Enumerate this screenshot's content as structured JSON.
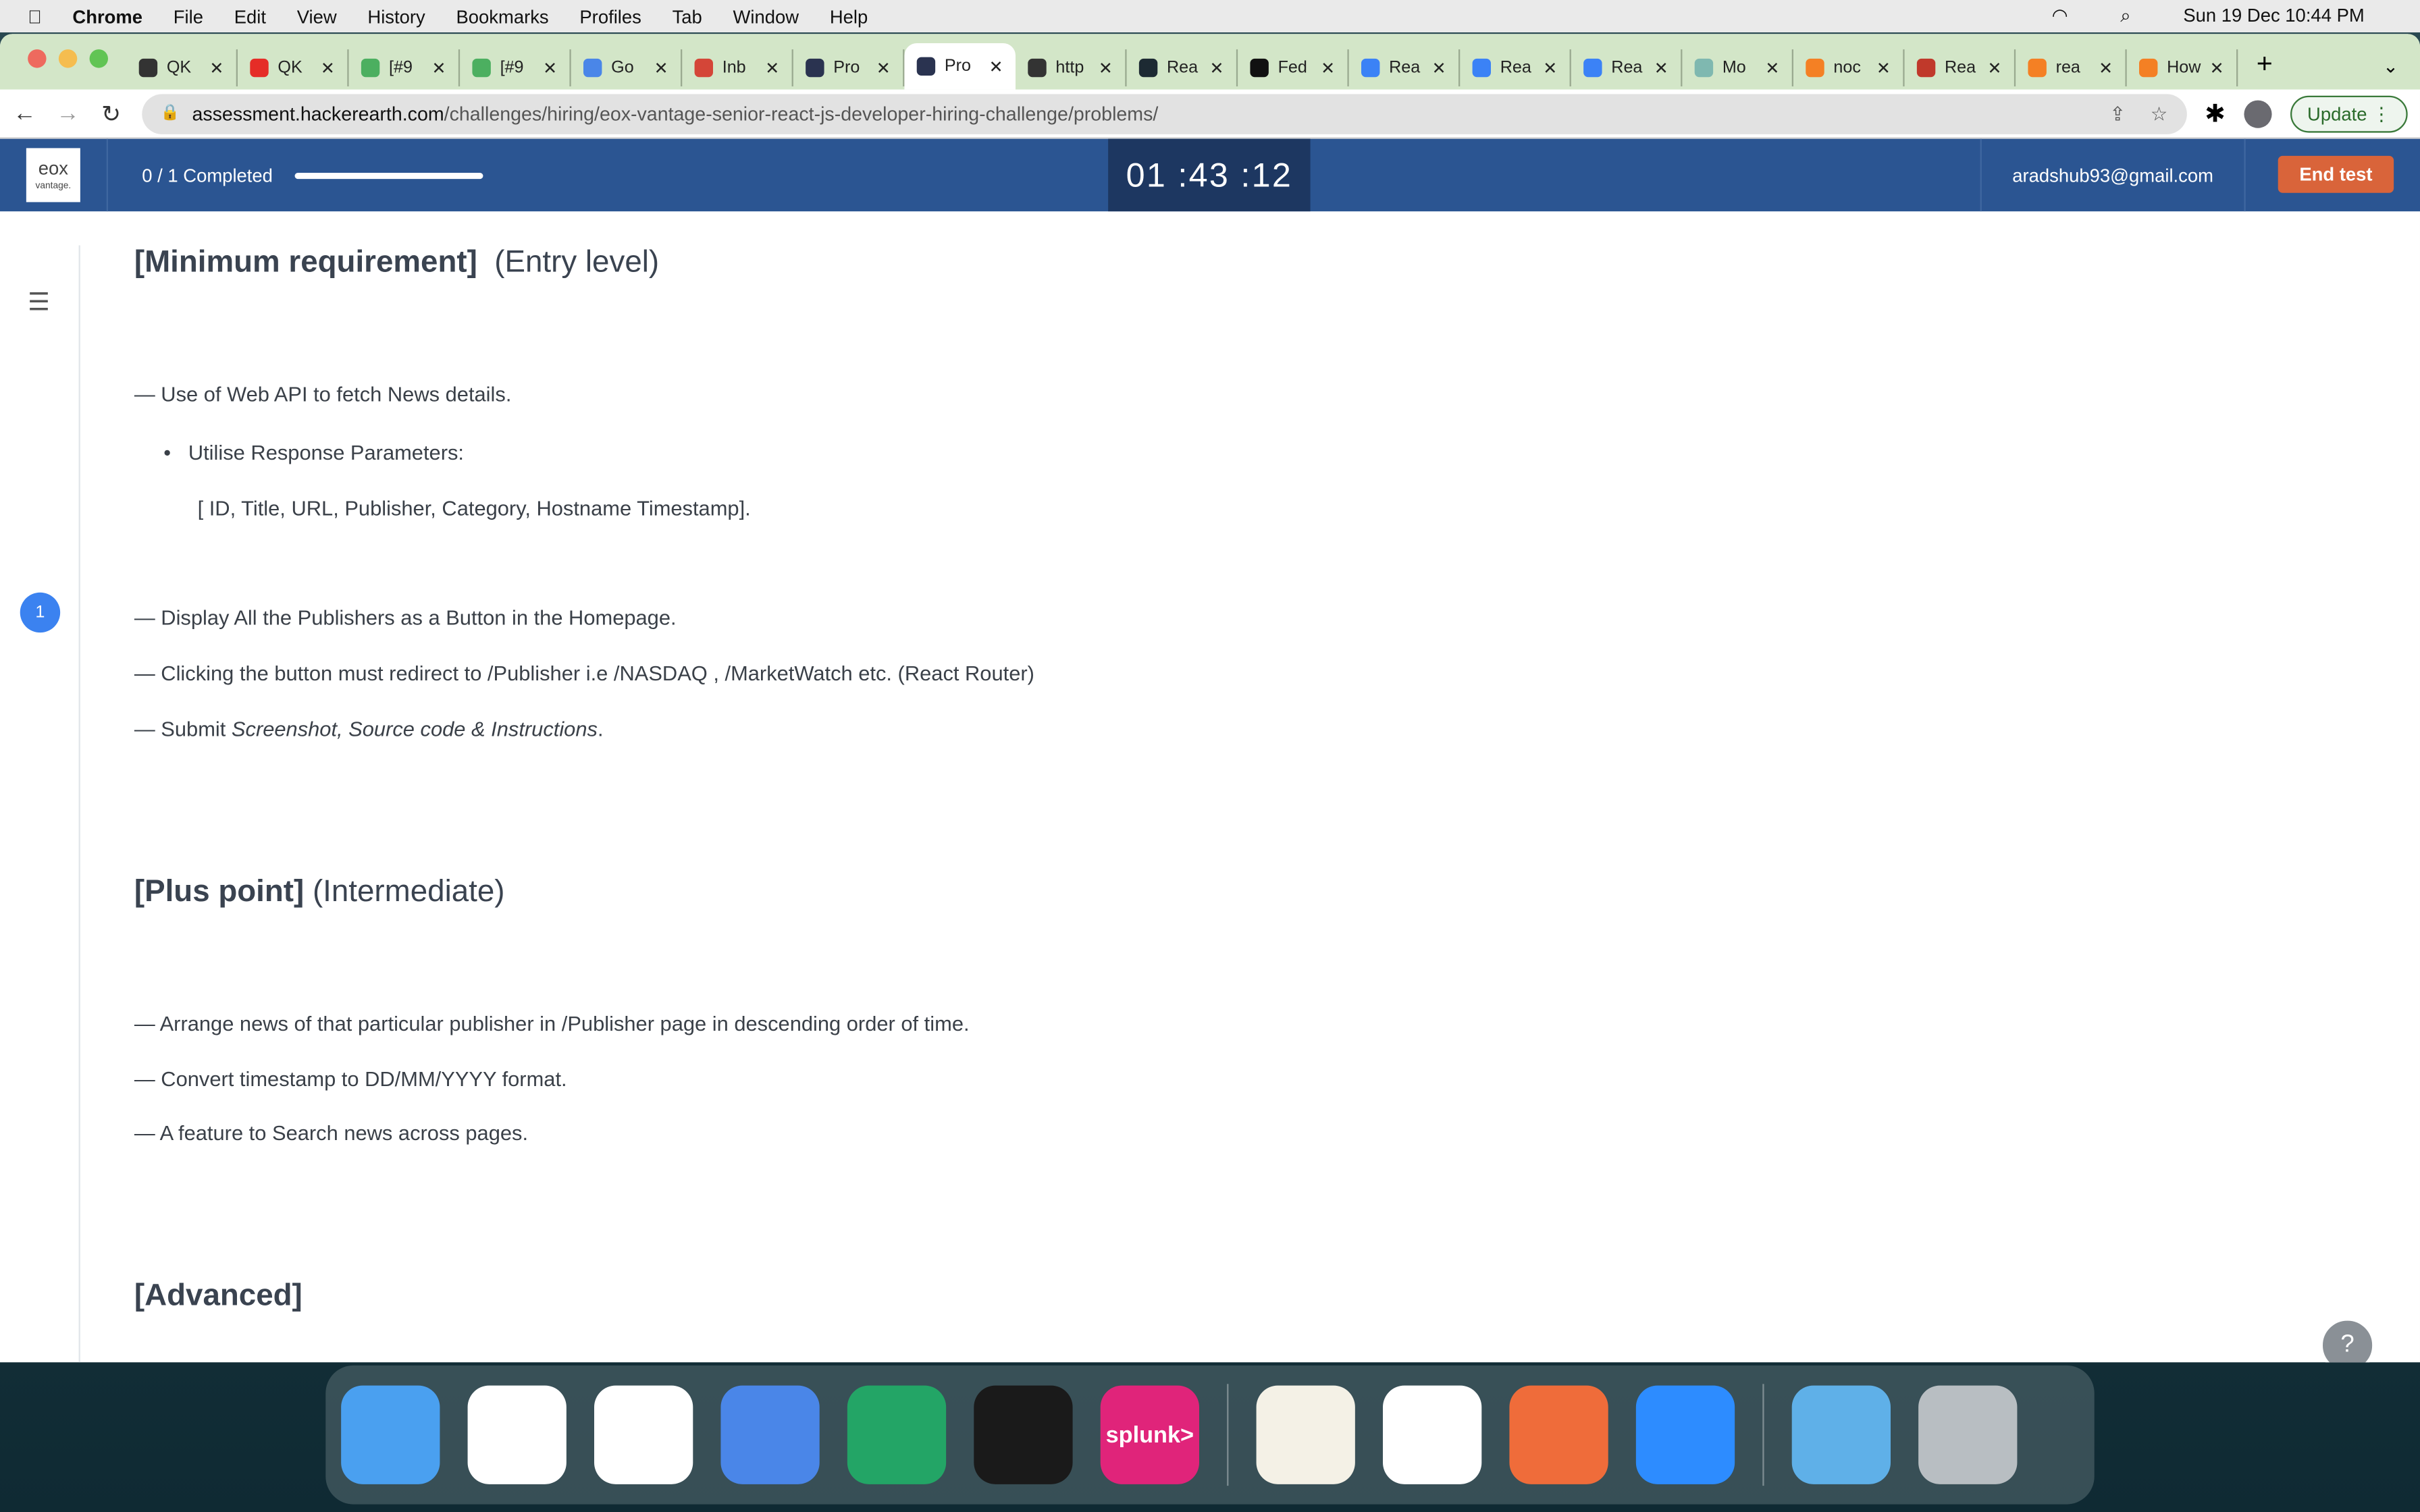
{
  "menubar": {
    "app": "Chrome",
    "items": [
      "File",
      "Edit",
      "View",
      "History",
      "Bookmarks",
      "Profiles",
      "Tab",
      "Window",
      "Help"
    ],
    "clock": "Sun 19 Dec  10:44 PM"
  },
  "tabs": [
    {
      "title": "QK",
      "color": "#333333"
    },
    {
      "title": "QK",
      "color": "#e52d27"
    },
    {
      "title": "[#9",
      "color": "#4caf60"
    },
    {
      "title": "[#9",
      "color": "#4caf60"
    },
    {
      "title": "Go",
      "color": "#4a86e8"
    },
    {
      "title": "Inb",
      "color": "#d44638"
    },
    {
      "title": "Pro",
      "color": "#2a3350"
    },
    {
      "title": "Pro",
      "color": "#2a3350",
      "active": true
    },
    {
      "title": "http",
      "color": "#333333"
    },
    {
      "title": "Rea",
      "color": "#1d2a33"
    },
    {
      "title": "Fed",
      "color": "#111111"
    },
    {
      "title": "Rea",
      "color": "#3b82f6"
    },
    {
      "title": "Rea",
      "color": "#3b82f6"
    },
    {
      "title": "Rea",
      "color": "#3b82f6"
    },
    {
      "title": "Mo",
      "color": "#7fb8b0"
    },
    {
      "title": "noc",
      "color": "#f48024"
    },
    {
      "title": "Rea",
      "color": "#c0392b"
    },
    {
      "title": "rea",
      "color": "#f48024"
    },
    {
      "title": "How to",
      "color": "#f48024"
    }
  ],
  "toolbar": {
    "url_host": "assessment.hackerearth.com",
    "url_path": "/challenges/hiring/eox-vantage-senior-react-js-developer-hiring-challenge/problems/",
    "update_label": "Update"
  },
  "header": {
    "logo_top": "eox",
    "logo_bottom": "vantage.",
    "progress_text": "0 / 1 Completed",
    "progress": 0,
    "timer": "01 :43 :12",
    "email": "aradshub93@gmail.com",
    "end_test": "End test"
  },
  "sidebar": {
    "question_number": "1"
  },
  "content": {
    "h1_bold": "[Minimum requirement]",
    "h1_rest": "(Entry level)",
    "l1": "— Use of Web API to fetch News details.",
    "l2": "Utilise Response Parameters:",
    "l3": "[ ID, Title, URL, Publisher, Category, Hostname Timestamp].",
    "l4": "— Display All the Publishers as a Button in the Homepage.",
    "l5": "— Clicking the button must redirect to /Publisher i.e /NASDAQ , /MarketWatch etc. (React Router)",
    "l6_pre": "— Submit ",
    "l6_em": "Screenshot, Source code & Instructions",
    "l6_post": ".",
    "h2_bold": "[Plus point]",
    "h2_rest": "(Intermediate)",
    "l7": "— Arrange news of that particular publisher in /Publisher page in descending order of time.",
    "l8": "— Convert timestamp to DD/MM/YYYY format.",
    "l9": "— A feature to Search news across pages.",
    "h3_bold": "[Advanced]"
  },
  "help": "?",
  "dock": [
    {
      "name": "finder",
      "bg": "#4aa0f0"
    },
    {
      "name": "chrome",
      "bg": "#ffffff"
    },
    {
      "name": "slack",
      "bg": "#ffffff"
    },
    {
      "name": "google-docs",
      "bg": "#4a86e8"
    },
    {
      "name": "google-sheets",
      "bg": "#23a566"
    },
    {
      "name": "terminal",
      "bg": "#1a1a1a"
    },
    {
      "name": "splunk",
      "bg": "#e0247a",
      "label": "splunk>"
    },
    {
      "name": "notes",
      "bg": "#f4f1e6"
    },
    {
      "name": "vscode",
      "bg": "#ffffff"
    },
    {
      "name": "postman",
      "bg": "#ef6c3a"
    },
    {
      "name": "zoom",
      "bg": "#2d8cff"
    },
    {
      "name": "downloads",
      "bg": "#5fb0e8"
    },
    {
      "name": "trash",
      "bg": "#b8bec2"
    }
  ]
}
